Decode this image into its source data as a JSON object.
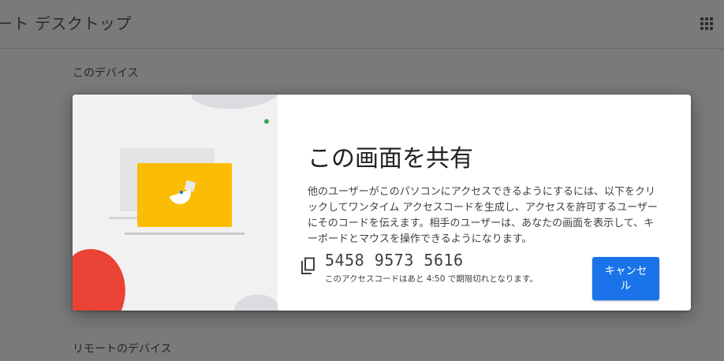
{
  "header": {
    "app_title": "ート デスクトップ",
    "apps_icon": "apps-grid-icon"
  },
  "sections": {
    "this_device": "このデバイス",
    "remote_devices": "リモートのデバイス"
  },
  "dialog": {
    "title": "この画面を共有",
    "body": "他のユーザーがこのパソコンにアクセスできるようにするには、以下をクリックしてワンタイム アクセスコードを生成し、アクセスを許可するユーザーにそのコードを伝えます。相手のユーザーは、あなたの画面を表示して、キーボードとマウスを操作できるようになります。",
    "access_code": "5458 9573 5616",
    "expiry_text": "このアクセスコードはあと 4:50 で期限切れとなります。",
    "copy_icon": "copy-icon",
    "cancel_label": "キャンセル"
  },
  "colors": {
    "accent": "#1a73e8",
    "illustration_yellow": "#fbbc04",
    "illustration_red": "#ea4335",
    "illustration_green": "#34a853"
  }
}
